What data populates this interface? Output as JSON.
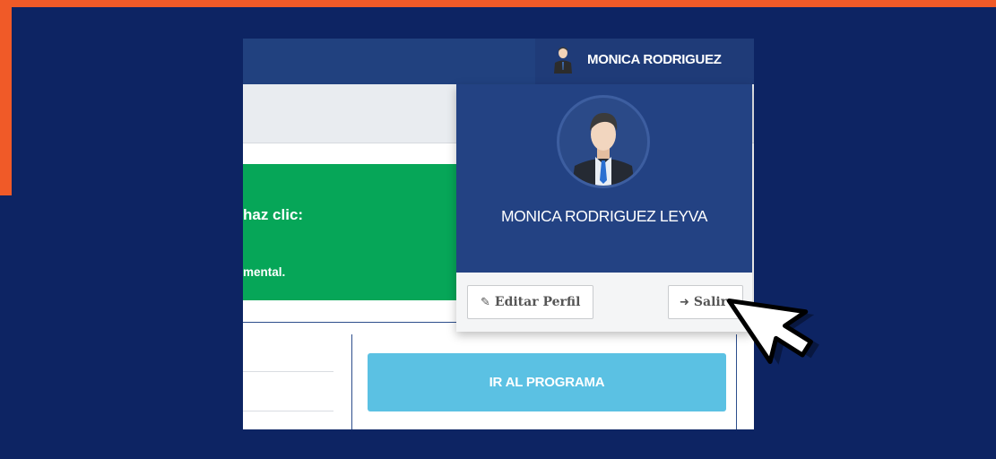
{
  "header": {
    "user_name": "MONICA RODRIGUEZ"
  },
  "banner": {
    "line1": "haz clic:",
    "line2": "mental."
  },
  "main": {
    "program_button": "IR AL PROGRAMA"
  },
  "dropdown": {
    "full_name": "MONICA RODRIGUEZ LEYVA",
    "edit_label": "Editar Perfil",
    "exit_label": "Salir",
    "edit_icon": "edit-icon",
    "exit_icon": "sign-in-icon"
  },
  "colors": {
    "orange": "#f05a28",
    "navy": "#0d2463",
    "topbar": "#21417f",
    "green": "#06a658",
    "program_button": "#5bc1e3"
  }
}
